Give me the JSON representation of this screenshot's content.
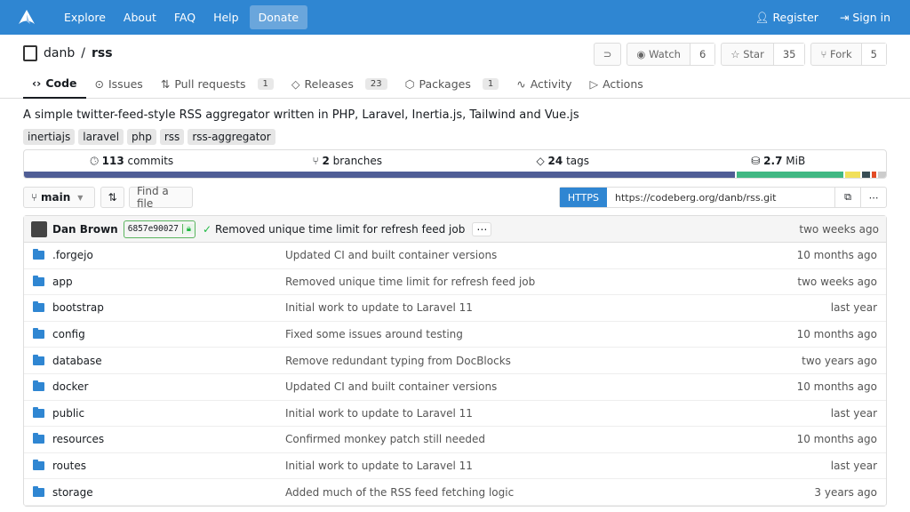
{
  "nav": {
    "items": [
      "Explore",
      "About",
      "FAQ",
      "Help",
      "Donate"
    ],
    "register": "Register",
    "signin": "Sign in"
  },
  "repo": {
    "owner": "danb",
    "sep": "/",
    "name": "rss",
    "watch": "Watch",
    "watch_count": "6",
    "star": "Star",
    "star_count": "35",
    "fork": "Fork",
    "fork_count": "5"
  },
  "tabs": [
    {
      "label": "Code"
    },
    {
      "label": "Issues"
    },
    {
      "label": "Pull requests",
      "badge": "1"
    },
    {
      "label": "Releases",
      "badge": "23"
    },
    {
      "label": "Packages",
      "badge": "1"
    },
    {
      "label": "Activity"
    },
    {
      "label": "Actions"
    }
  ],
  "description": "A simple twitter-feed-style RSS aggregator written in PHP, Laravel, Inertia.js, Tailwind and Vue.js",
  "topics": [
    "inertiajs",
    "laravel",
    "php",
    "rss",
    "rss-aggregator"
  ],
  "stats": {
    "commits_n": "113",
    "commits": "commits",
    "branches_n": "2",
    "branches": "branches",
    "tags_n": "24",
    "tags": "tags",
    "size": "2.7",
    "size_unit": "MiB"
  },
  "languages": [
    {
      "color": "#4f5d95",
      "percent": 82.6
    },
    {
      "color": "#41b883",
      "percent": 12.4
    },
    {
      "color": "#f1e05a",
      "percent": 1.7
    },
    {
      "color": "#384d54",
      "percent": 1.0
    },
    {
      "color": "#e34c26",
      "percent": 0.5
    },
    {
      "color": "#cccccc",
      "percent": 0.9
    }
  ],
  "branch": {
    "current": "main",
    "find_file": "Find a file",
    "https": "HTTPS",
    "clone_url": "https://codeberg.org/danb/rss.git"
  },
  "last_commit": {
    "author": "Dan Brown",
    "sha": "6857e90027",
    "message": "Removed unique time limit for refresh feed job",
    "time": "two weeks ago"
  },
  "files": [
    {
      "name": ".forgejo",
      "message": "Updated CI and built container versions",
      "time": "10 months ago"
    },
    {
      "name": "app",
      "message": "Removed unique time limit for refresh feed job",
      "time": "two weeks ago"
    },
    {
      "name": "bootstrap",
      "message": "Initial work to update to Laravel 11",
      "time": "last year"
    },
    {
      "name": "config",
      "message": "Fixed some issues around testing",
      "time": "10 months ago"
    },
    {
      "name": "database",
      "message": "Remove redundant typing from DocBlocks",
      "time": "two years ago"
    },
    {
      "name": "docker",
      "message": "Updated CI and built container versions",
      "time": "10 months ago"
    },
    {
      "name": "public",
      "message": "Initial work to update to Laravel 11",
      "time": "last year"
    },
    {
      "name": "resources",
      "message": "Confirmed monkey patch still needed",
      "time": "10 months ago"
    },
    {
      "name": "routes",
      "message": "Initial work to update to Laravel 11",
      "time": "last year"
    },
    {
      "name": "storage",
      "message": "Added much of the RSS feed fetching logic",
      "time": "3 years ago"
    }
  ]
}
